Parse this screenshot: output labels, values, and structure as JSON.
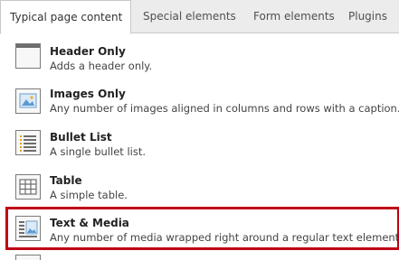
{
  "tabs": [
    {
      "label": "Typical page content",
      "active": true
    },
    {
      "label": "Special elements",
      "active": false
    },
    {
      "label": "Form elements",
      "active": false
    },
    {
      "label": "Plugins",
      "active": false
    }
  ],
  "items": [
    {
      "title": "Header Only",
      "description": "Adds a header only.",
      "icon": "header-icon"
    },
    {
      "title": "Images Only",
      "description": "Any number of images aligned in columns and rows with a caption.",
      "icon": "image-icon"
    },
    {
      "title": "Bullet List",
      "description": "A single bullet list.",
      "icon": "bullet-list-icon"
    },
    {
      "title": "Table",
      "description": "A simple table.",
      "icon": "table-icon"
    },
    {
      "title": "Text & Media",
      "description": "Any number of media wrapped right around a regular text element.",
      "icon": "text-media-icon",
      "selected": true
    }
  ],
  "colors": {
    "highlight": "#c00016",
    "tab_bar": "#ececec",
    "accent_blue": "#5a9bd5"
  }
}
